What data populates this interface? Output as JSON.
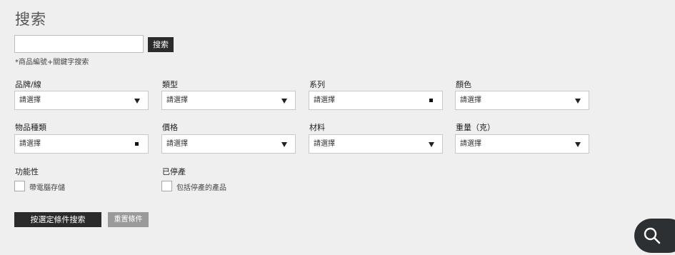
{
  "page": {
    "title": "搜索"
  },
  "search": {
    "value": "",
    "placeholder": "",
    "button_label": "搜索",
    "hint": "*商品編號+關鍵字搜索"
  },
  "filters": [
    {
      "label": "品牌/線",
      "value": "請選擇",
      "indicator": "arrow"
    },
    {
      "label": "類型",
      "value": "請選擇",
      "indicator": "arrow"
    },
    {
      "label": "系列",
      "value": "請選擇",
      "indicator": "square"
    },
    {
      "label": "顏色",
      "value": "請選擇",
      "indicator": "arrow"
    },
    {
      "label": "物品種類",
      "value": "請選擇",
      "indicator": "square"
    },
    {
      "label": "價格",
      "value": "請選擇",
      "indicator": "arrow"
    },
    {
      "label": "材料",
      "value": "請選擇",
      "indicator": "arrow"
    },
    {
      "label": "重量（克）",
      "value": "請選擇",
      "indicator": "arrow"
    }
  ],
  "checkbox_groups": [
    {
      "label": "功能性",
      "option": "帶電腦存儲",
      "checked": false
    },
    {
      "label": "已停產",
      "option": "包括停產的產品",
      "checked": false
    }
  ],
  "actions": {
    "apply_label": "按選定條件搜索",
    "reset_label": "重置條件"
  },
  "floating_button": {
    "icon": "search-icon"
  },
  "colors": {
    "background": "#efefef",
    "primary_button": "#2b2b2b",
    "secondary_button": "#9a9a9a",
    "fab": "#2c3033"
  }
}
